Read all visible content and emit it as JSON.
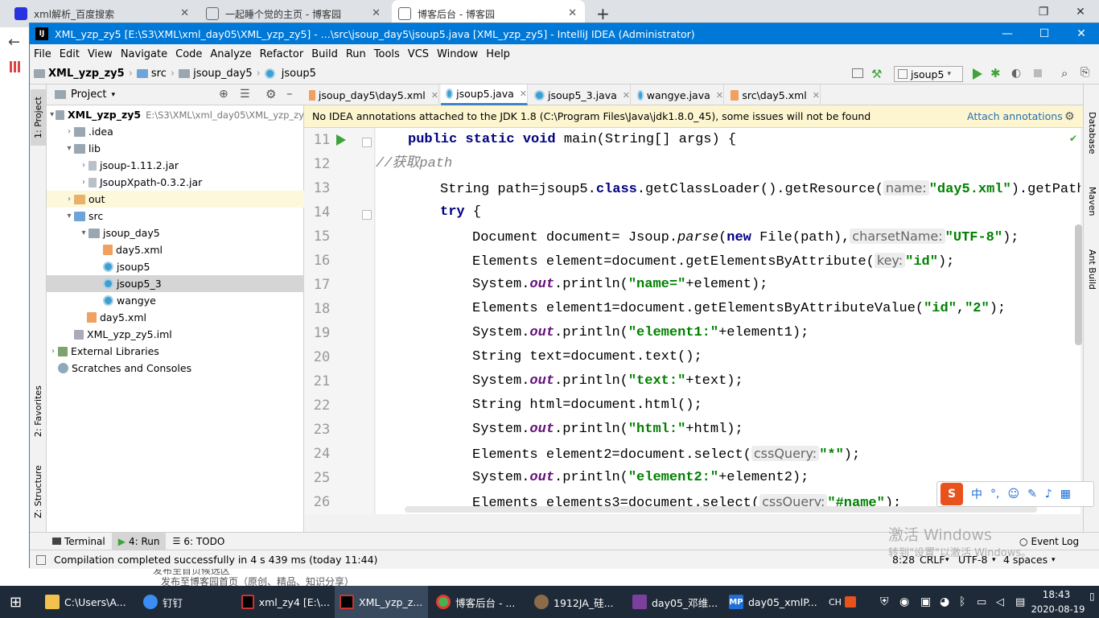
{
  "browser": {
    "tabs": [
      {
        "label": "xml解析_百度搜索"
      },
      {
        "label": "一起睡个觉的主页 - 博客园"
      },
      {
        "label": "博客后台 - 博客园"
      }
    ],
    "new_tab": "+"
  },
  "ide": {
    "title": "XML_yzp_zy5 [E:\\S3\\XML\\xml_day05\\XML_yzp_zy5] - ...\\src\\jsoup_day5\\jsoup5.java [XML_yzp_zy5] - IntelliJ IDEA (Administrator)",
    "logo": "IJ",
    "menu": [
      "File",
      "Edit",
      "View",
      "Navigate",
      "Code",
      "Analyze",
      "Refactor",
      "Build",
      "Run",
      "Tools",
      "VCS",
      "Window",
      "Help"
    ],
    "breadcrumbs": [
      "XML_yzp_zy5",
      "src",
      "jsoup_day5",
      "jsoup5"
    ],
    "run_config": "jsoup5",
    "left_tabs": {
      "project": "1: Project",
      "favorites": "2: Favorites",
      "structure": "Z: Structure"
    },
    "right_tabs": {
      "database": "Database",
      "maven": "Maven",
      "ant": "Ant Build"
    },
    "project_panel": {
      "title": "Project",
      "tree": [
        {
          "label": "XML_yzp_zy5",
          "extra": "E:\\S3\\XML\\xml_day05\\XML_yzp_zy"
        },
        {
          "label": ".idea"
        },
        {
          "label": "lib"
        },
        {
          "label": "jsoup-1.11.2.jar"
        },
        {
          "label": "JsoupXpath-0.3.2.jar"
        },
        {
          "label": "out"
        },
        {
          "label": "src"
        },
        {
          "label": "jsoup_day5"
        },
        {
          "label": "day5.xml"
        },
        {
          "label": "jsoup5"
        },
        {
          "label": "jsoup5_3"
        },
        {
          "label": "wangye"
        },
        {
          "label": "day5.xml"
        },
        {
          "label": "XML_yzp_zy5.iml"
        },
        {
          "label": "External Libraries"
        },
        {
          "label": "Scratches and Consoles"
        }
      ]
    },
    "editor_tabs": [
      "jsoup_day5\\day5.xml",
      "jsoup5.java",
      "jsoup5_3.java",
      "wangye.java",
      "src\\day5.xml"
    ],
    "banner": {
      "message": "No IDEA annotations attached to the JDK 1.8 (C:\\Program Files\\Java\\jdk1.8.0_45), some issues will not be found",
      "action": "Attach annotations"
    },
    "line_numbers": [
      "11",
      "12",
      "13",
      "14",
      "15",
      "16",
      "17",
      "18",
      "19",
      "20",
      "21",
      "22",
      "23",
      "24",
      "25",
      "26"
    ],
    "code": {
      "l11a": "public static void",
      "l11b": " main(String[] args) {",
      "l12": "//获取path",
      "l13a": "String path=jsoup5.",
      "l13b": "class",
      "l13c": ".getClassLoader().getResource(",
      "l13h": "name:",
      "l13s": "\"day5.xml\"",
      "l13d": ").getPath",
      "l14": "try",
      "l14b": " {",
      "l15a": "Document document= Jsoup.",
      "l15p": "parse",
      "l15b": "(",
      "l15n": "new",
      "l15c": " File(path),",
      "l15h": "charsetName:",
      "l15s": "\"UTF-8\"",
      "l15d": ");",
      "l16a": "Elements element=document.getElementsByAttribute(",
      "l16h": "key:",
      "l16s": "\"id\"",
      "l16d": ");",
      "l17a": "System.",
      "l17o": "out",
      "l17b": ".println(",
      "l17s": "\"name=\"",
      "l17c": "+element);",
      "l18a": "Elements element1=document.getElementsByAttributeValue(",
      "l18s1": "\"id\"",
      "l18m": ",",
      "l18s2": "\"2\"",
      "l18d": ");",
      "l19a": "System.",
      "l19o": "out",
      "l19b": ".println(",
      "l19s": "\"element1:\"",
      "l19c": "+element1);",
      "l20": "String text=document.text();",
      "l21a": "System.",
      "l21o": "out",
      "l21b": ".println(",
      "l21s": "\"text:\"",
      "l21c": "+text);",
      "l22": "String html=document.html();",
      "l23a": "System.",
      "l23o": "out",
      "l23b": ".println(",
      "l23s": "\"html:\"",
      "l23c": "+html);",
      "l24a": "Elements element2=document.select(",
      "l24h": "cssQuery:",
      "l24s": "\"*\"",
      "l24d": ");",
      "l25a": "System.",
      "l25o": "out",
      "l25b": ".println(",
      "l25s": "\"element2:\"",
      "l25c": "+element2);",
      "l26a": "Elements elements3=document.select(",
      "l26h": "cssQuery:",
      "l26s": "\"#name\"",
      "l26d": ");"
    },
    "bottom_tabs": {
      "terminal": "Terminal",
      "run": "4: Run",
      "todo": "6: TODO",
      "event_log": "Event Log"
    },
    "status": {
      "message": "Compilation completed successfully in 4 s 439 ms (today 11:44)",
      "position": "8:28",
      "line_sep": "CRLF",
      "encoding": "UTF-8",
      "indent": "4 spaces"
    }
  },
  "background_page": {
    "line1": "发布至首页候选区",
    "line2": "发布至博客园首页（原创、精品、知识分享）"
  },
  "watermark": {
    "line1": "激活 Windows",
    "line2": "转到\"设置\"以激活 Windows。"
  },
  "ime": {
    "lang": "中"
  },
  "taskbar": {
    "items": [
      "C:\\Users\\A...",
      "钉钉",
      "xml_zy4 [E:\\...",
      "XML_yzp_z...",
      "博客后台 - ...",
      "1912JA_硅...",
      "day05_邓维...",
      "day05_xmlP..."
    ],
    "tray_lang": "CH",
    "time": "18:43",
    "date": "2020-08-19"
  }
}
